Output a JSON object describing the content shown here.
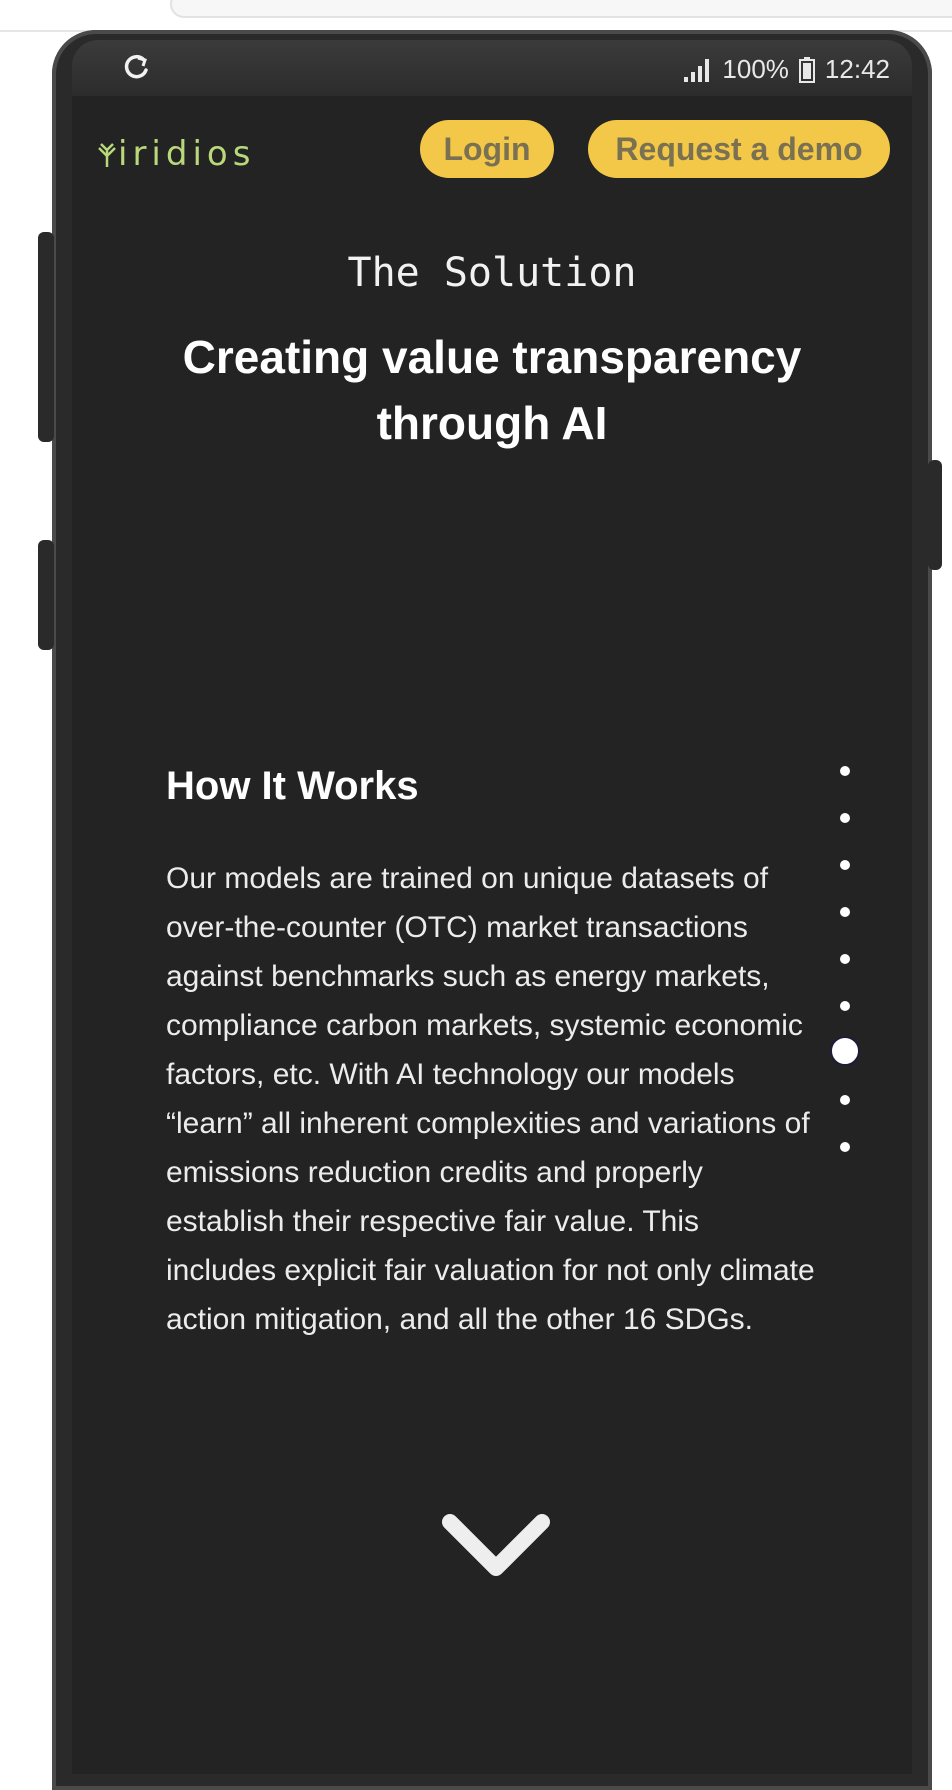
{
  "status_bar": {
    "battery": "100%",
    "time": "12:42",
    "icons": [
      "refresh-icon",
      "signal-icon",
      "battery-icon"
    ]
  },
  "header": {
    "logo_text": "iridios",
    "login_label": "Login",
    "demo_label": "Request a demo"
  },
  "hero": {
    "eyebrow": "The Solution",
    "headline": "Creating value transparency through AI"
  },
  "section": {
    "title": "How It Works",
    "body": "Our models are trained on unique datasets of over-the-counter (OTC) market transactions against benchmarks such as energy markets, compliance carbon markets, systemic economic factors, etc. With AI technology our models “learn” all inherent complexities and variations of emissions reduction credits and properly establish their respective fair value. This includes explicit fair valuation for not only climate action mitigation, and all the other 16 SDGs."
  },
  "pagination": {
    "total": 9,
    "active_index": 6
  },
  "colors": {
    "background": "#232323",
    "button": "#f3c748",
    "button_text": "#7a7152",
    "logo": "#b9d87a",
    "text": "#ffffff"
  }
}
